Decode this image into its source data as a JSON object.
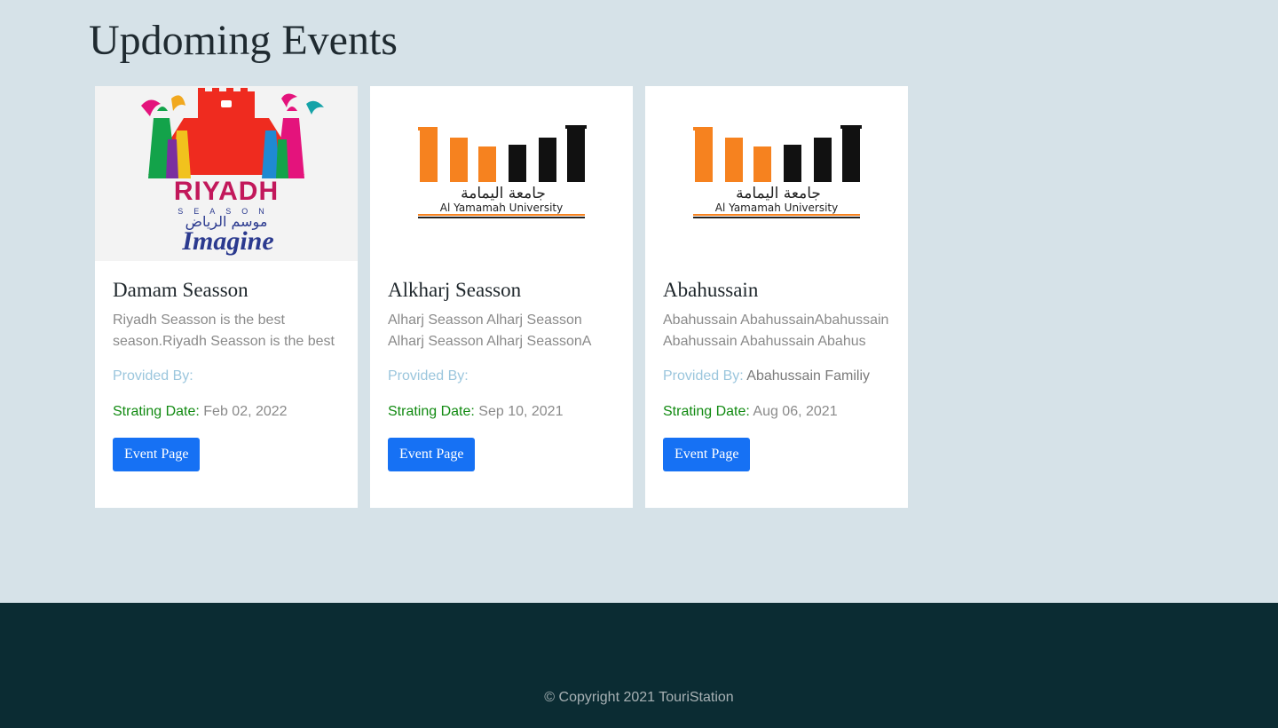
{
  "page": {
    "title": "Updoming Events"
  },
  "cards": [
    {
      "image": "riyadh-season-logo",
      "logo_text": {
        "main": "RIYADH",
        "season": "SEASON",
        "arabic": "موسم الرياض",
        "tagline": "Imagine"
      },
      "title": "Damam Seasson",
      "desc_line1": "Riyadh Seasson is the best",
      "desc_line2": "season.Riyadh Seasson is the best",
      "provided_label": "Provided By:",
      "provided_value": "",
      "start_label": "Strating Date:",
      "start_value": "Feb 02, 2022",
      "button": "Event Page"
    },
    {
      "image": "al-yamamah-university-logo",
      "logo_text": {
        "arabic": "جامعة اليمامة",
        "english": "Al Yamamah University"
      },
      "title": "Alkharj Seasson",
      "desc_line1": "Alharj Seasson Alharj Seasson",
      "desc_line2": "Alharj Seasson Alharj SeassonA",
      "provided_label": "Provided By:",
      "provided_value": "",
      "start_label": "Strating Date:",
      "start_value": "Sep 10, 2021",
      "button": "Event Page"
    },
    {
      "image": "al-yamamah-university-logo",
      "logo_text": {
        "arabic": "جامعة اليمامة",
        "english": "Al Yamamah University"
      },
      "title": "Abahussain",
      "desc_line1": "Abahussain AbahussainAbahussain",
      "desc_line2": "Abahussain Abahussain Abahus",
      "provided_label": "Provided By:",
      "provided_value": "Abahussain Familiy",
      "start_label": "Strating Date:",
      "start_value": "Aug 06, 2021",
      "button": "Event Page"
    }
  ],
  "footer": {
    "copyright": "© Copyright 2021 TouriStation"
  },
  "colors": {
    "background": "#d6e2e8",
    "footer": "#0b2c33",
    "button": "#1671f4",
    "provided_label": "#9bc6dd",
    "start_label": "#118a11"
  }
}
